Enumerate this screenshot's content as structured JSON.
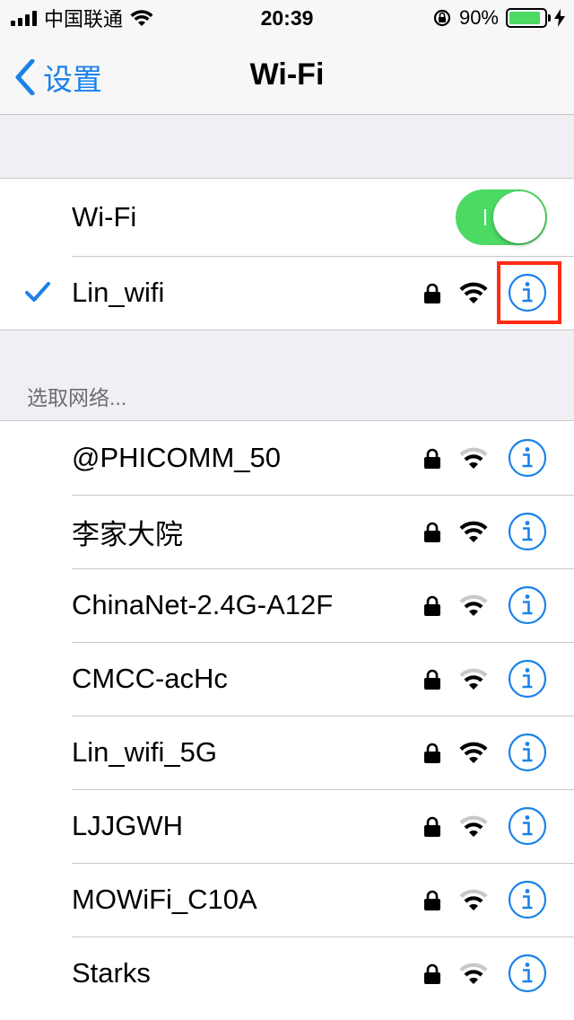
{
  "status": {
    "carrier": "中国联通",
    "time": "20:39",
    "battery": "90%",
    "battery_level": 0.9
  },
  "nav": {
    "back_label": "设置",
    "title": "Wi-Fi"
  },
  "wifi_toggle": {
    "label": "Wi-Fi",
    "on": true
  },
  "connected": {
    "name": "Lin_wifi",
    "locked": true,
    "strength": "full"
  },
  "section_label": "选取网络...",
  "networks": [
    {
      "name": "@PHICOMM_50",
      "locked": true,
      "strength": "weak"
    },
    {
      "name": "李家大院",
      "locked": true,
      "strength": "full"
    },
    {
      "name": "ChinaNet-2.4G-A12F",
      "locked": true,
      "strength": "weak"
    },
    {
      "name": "CMCC-acHc",
      "locked": true,
      "strength": "weak"
    },
    {
      "name": "Lin_wifi_5G",
      "locked": true,
      "strength": "full"
    },
    {
      "name": "LJJGWH",
      "locked": true,
      "strength": "weak"
    },
    {
      "name": "MOWiFi_C10A",
      "locked": true,
      "strength": "weak"
    },
    {
      "name": "Starks",
      "locked": true,
      "strength": "weak"
    }
  ],
  "colors": {
    "accent": "#1a82e8",
    "toggle_on": "#4cd964",
    "highlight": "#ff2a14"
  },
  "icons": {
    "back": "chevron-left-icon",
    "lock": "lock-icon",
    "wifi": "wifi-signal-icon",
    "info": "info-icon",
    "check": "checkmark-icon"
  }
}
